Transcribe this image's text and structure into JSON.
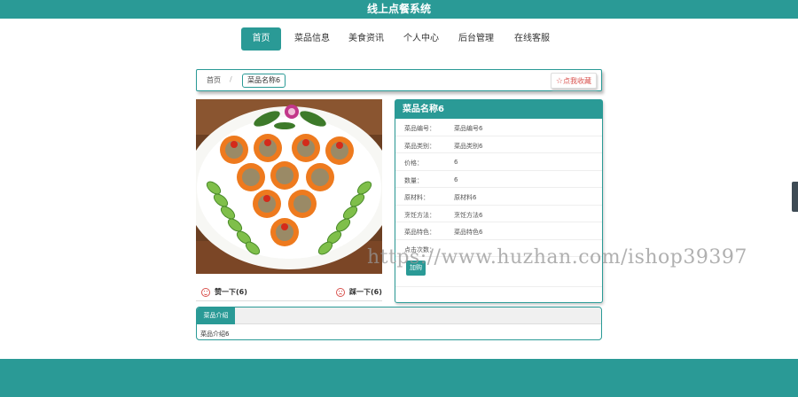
{
  "header": {
    "title": "线上点餐系统"
  },
  "nav": {
    "items": [
      {
        "label": "首页",
        "active": true
      },
      {
        "label": "菜品信息",
        "active": false
      },
      {
        "label": "美食资讯",
        "active": false
      },
      {
        "label": "个人中心",
        "active": false
      },
      {
        "label": "后台管理",
        "active": false
      },
      {
        "label": "在线客服",
        "active": false
      }
    ]
  },
  "breadcrumb": {
    "home": "首页",
    "separator": "/",
    "current": "菜品名称6"
  },
  "favorite": {
    "icon": "star-icon",
    "label": "点我收藏"
  },
  "votes": {
    "up": "赞一下(6)",
    "down": "踩一下(6)"
  },
  "detail": {
    "title": "菜品名称6",
    "rows": [
      {
        "k": "菜品编号：",
        "v": "菜品编号6"
      },
      {
        "k": "菜品类别：",
        "v": "菜品类别6"
      },
      {
        "k": "价格：",
        "v": "6"
      },
      {
        "k": "数量：",
        "v": "6"
      },
      {
        "k": "原材料：",
        "v": "原材料6"
      },
      {
        "k": "烹饪方法：",
        "v": "烹饪方法6"
      },
      {
        "k": "菜品特色：",
        "v": "菜品特色6"
      },
      {
        "k": "点击次数：",
        "v": ""
      }
    ],
    "buy_label": "加购"
  },
  "description": {
    "tab": "菜品介绍",
    "text": "菜品介绍6"
  },
  "watermark": "https://www.huzhan.com/ishop39397",
  "colors": {
    "primary": "#2a9a96",
    "danger": "#d9534f"
  }
}
